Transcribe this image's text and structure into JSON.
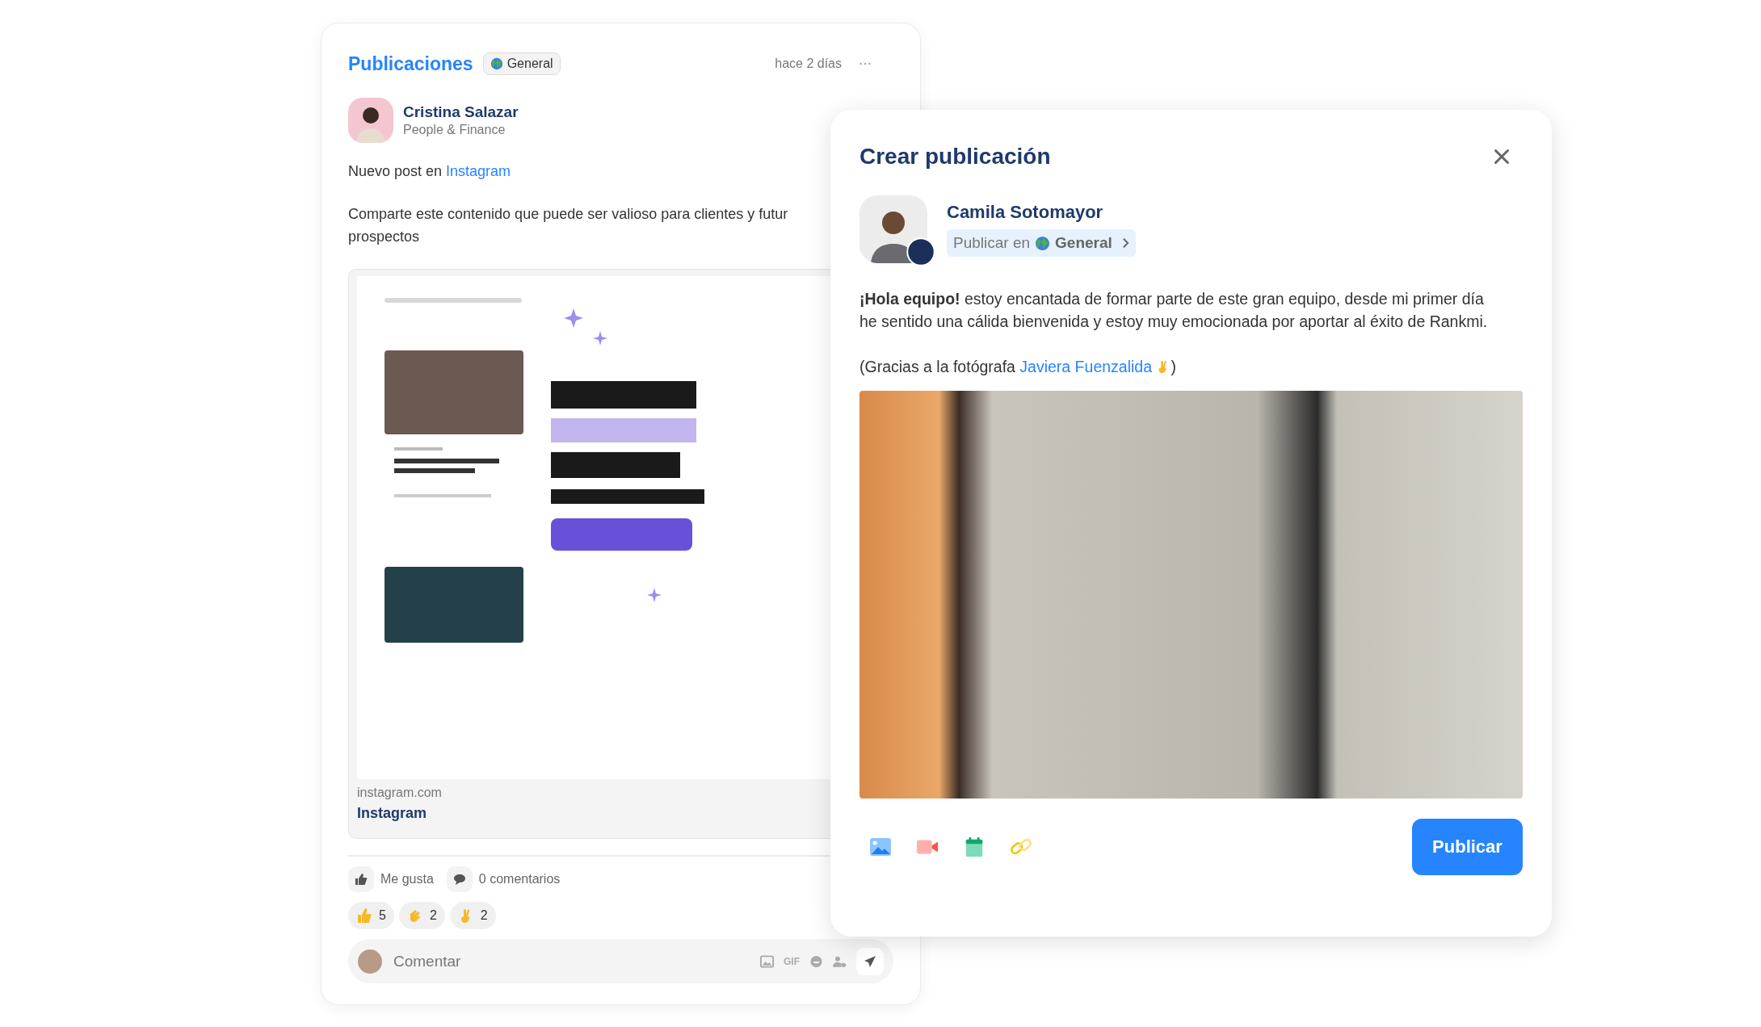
{
  "feed_card": {
    "title": "Publicaciones",
    "audience": "General",
    "time": "hace 2 días",
    "author": {
      "name": "Cristina Salazar",
      "team": "People & Finance"
    },
    "intro": {
      "text": "Nuevo post en ",
      "link": "Instagram"
    },
    "body_lines": [
      "Comparte este contenido que puede ser valioso para clientes y futur",
      "prospectos"
    ],
    "link_preview": {
      "domain": "instagram.com",
      "title": "Instagram"
    },
    "actions": [
      {
        "label": "Me gusta"
      },
      {
        "label": "0 comentarios"
      }
    ],
    "reactions": [
      {
        "count": "5"
      },
      {
        "count": "2"
      },
      {
        "count": "2"
      }
    ],
    "comment": {
      "placeholder": "Comentar",
      "gif": "GIF"
    }
  },
  "create_post": {
    "title": "Crear publicación",
    "author": {
      "name": "Camila Sotomayor"
    },
    "audience_prefix": "Publicar en",
    "audience": "General",
    "message": "**¡Hola equipo!** estoy encantada de formar parte de este gran equipo, desde mi primer día he sentido una cálida bienvenida y estoy muy emocionada por aportar al éxito de Rankmi.",
    "credit": {
      "before": "(Gracias a la fotógrafa ",
      "link": "Javiera Fuenzalida",
      "after": ")"
    },
    "submit": "Publicar"
  }
}
